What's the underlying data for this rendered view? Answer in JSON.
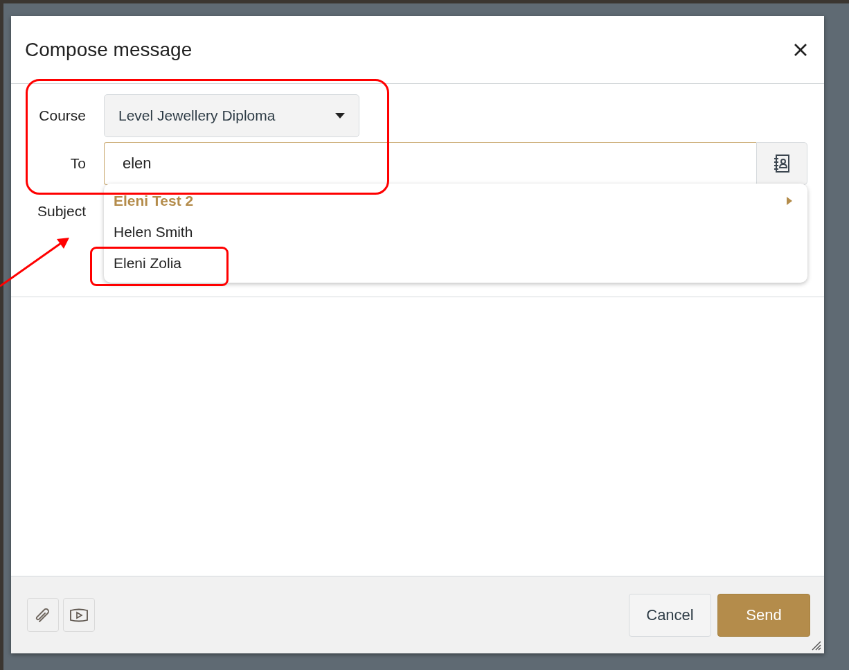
{
  "dialog": {
    "title": "Compose message"
  },
  "form": {
    "course_label": "Course",
    "course_value": "Level Jewellery Diploma",
    "to_label": "To",
    "to_value": "elen",
    "subject_label": "Subject"
  },
  "suggestions": [
    {
      "label": "Eleni Test 2",
      "selected": true,
      "expandable": true
    },
    {
      "label": "Helen Smith",
      "selected": false,
      "expandable": false
    },
    {
      "label": "Eleni Zolia",
      "selected": false,
      "expandable": false
    }
  ],
  "buttons": [
    {
      "label": "Cancel",
      "kind": "secondary"
    },
    {
      "label": "Send",
      "kind": "primary"
    }
  ]
}
